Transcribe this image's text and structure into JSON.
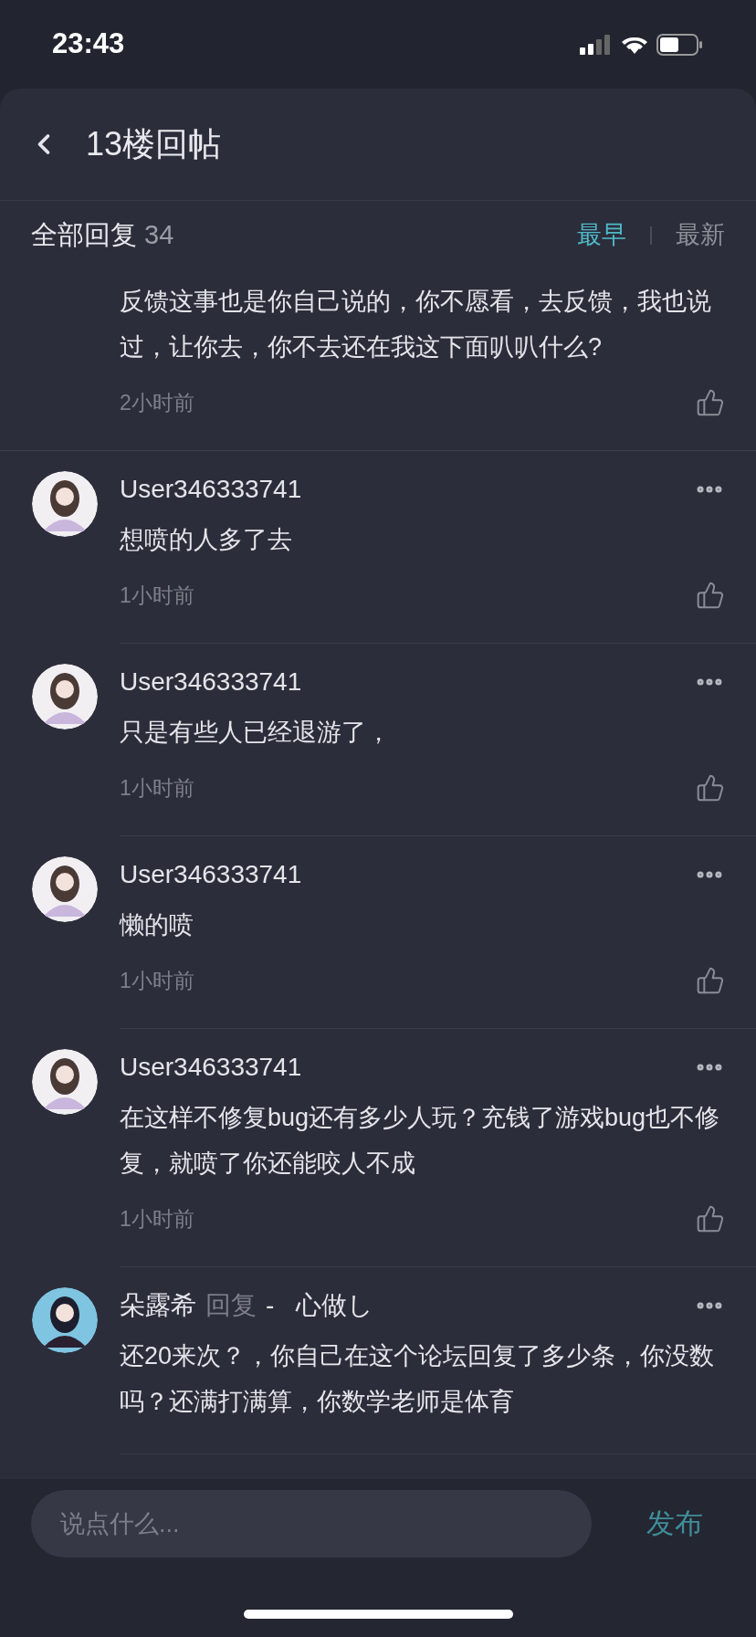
{
  "status_bar": {
    "time": "23:43"
  },
  "header": {
    "title": "13楼回帖"
  },
  "replies_bar": {
    "label": "全部回复",
    "count": "34",
    "sort_tabs": [
      {
        "label": "最早",
        "selected": true
      },
      {
        "label": "最新",
        "selected": false
      }
    ]
  },
  "partial_comment": {
    "text": "反馈这事也是你自己说的，你不愿看，去反馈，我也说过，让你去，你不去还在我这下面叭叭什么?",
    "time": "2小时前"
  },
  "comments": [
    {
      "kind": "plain",
      "user": "User346333741",
      "text": "想喷的人多了去",
      "time": "1小时前"
    },
    {
      "kind": "plain",
      "user": "User346333741",
      "text": "只是有些人已经退游了，",
      "time": "1小时前"
    },
    {
      "kind": "plain",
      "user": "User346333741",
      "text": "懒的喷",
      "time": "1小时前"
    },
    {
      "kind": "plain",
      "user": "User346333741",
      "text": "在这样不修复bug还有多少人玩？充钱了游戏bug也不修复，就喷了你还能咬人不成",
      "time": "1小时前"
    },
    {
      "kind": "reply",
      "user": "朵露希",
      "reply_label": "回复",
      "reply_to": "-   心做し",
      "text": "还20来次？，你自己在这个论坛回复了多少条，你没数吗？还满打满算，你数学老师是体育"
    }
  ],
  "composer": {
    "placeholder": "说点什么...",
    "send": "发布"
  }
}
